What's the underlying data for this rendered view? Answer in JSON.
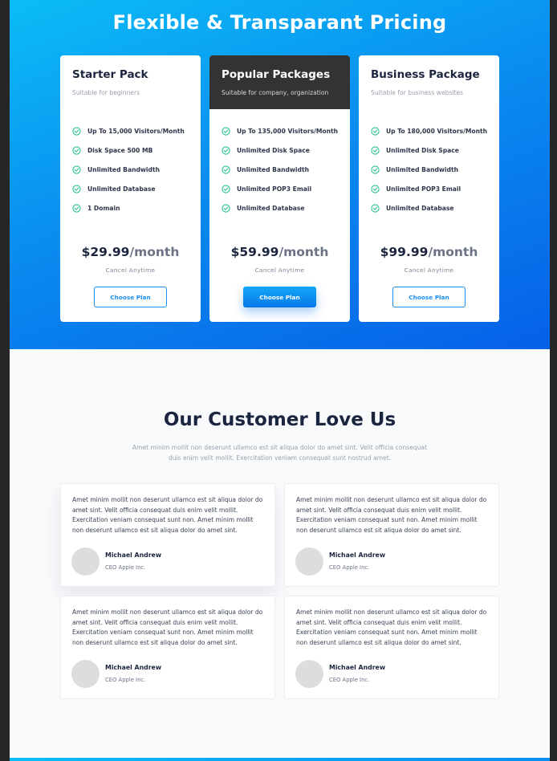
{
  "pricing": {
    "title": "Flexible & Transparant Pricing",
    "plans": [
      {
        "name": "Starter Pack",
        "description": "Suitable for beginners",
        "features": [
          "Up To 15,000 Visitors/Month",
          "Disk Space 500 MB",
          "Unlimited Bandwidth",
          "Unlimited Database",
          "1 Domain"
        ],
        "price": "$29.99",
        "period": "/month",
        "note": "Cancel Anytime",
        "button": "Choose Plan",
        "featured": false
      },
      {
        "name": "Popular Packages",
        "description": "Suitable for company, organization",
        "features": [
          "Up To 135,000 Visitors/Month",
          "Unlimited Disk Space",
          "Unlimited Bandwidth",
          "Unlimited POP3 Email",
          "Unlimited Database"
        ],
        "price": "$59.99",
        "period": "/month",
        "note": "Cancel Anytime",
        "button": "Choose Plan",
        "featured": true
      },
      {
        "name": "Business Package",
        "description": "Suitable for business websites",
        "features": [
          "Up To 180,000 Visitors/Month",
          "Unlimited Disk Space",
          "Unlimited Bandwidth",
          "Unlimited POP3 Email",
          "Unlimited Database"
        ],
        "price": "$99.99",
        "period": "/month",
        "note": "Cancel Anytime",
        "button": "Choose Plan",
        "featured": false
      }
    ],
    "check_icon": "check-circle-icon"
  },
  "testimonials": {
    "title": "Our Customer Love Us",
    "subtitle": "Amet minim mollit non deserunt ullamco est sit aliqua dolor do amet sint. Velit officia consequat duis enim velit mollit. Exercitation veniam consequat sunt nostrud amet.",
    "items": [
      {
        "quote": "Amet minim mollit non deserunt ullamco est sit aliqua dolor do amet sint. Velit officia consequat duis enim velit mollit. Exercitation veniam consequat sunt non. Amet minim mollit non deserunt ullamco est sit aliqua dolor do amet sint.",
        "name": "Michael Andrew",
        "role": "CEO Apple Inc."
      },
      {
        "quote": "Amet minim mollit non deserunt ullamco est sit aliqua dolor do amet sint. Velit officia consequat duis enim velit mollit. Exercitation veniam consequat sunt non. Amet minim mollit non deserunt ullamco est sit aliqua dolor do amet sint.",
        "name": "Michael Andrew",
        "role": "CEO Apple Inc."
      },
      {
        "quote": "Amet minim mollit non deserunt ullamco est sit aliqua dolor do amet sint. Velit officia consequat duis enim velit mollit. Exercitation veniam consequat sunt non. Amet minim mollit non deserunt ullamco est sit aliqua dolor do amet sint.",
        "name": "Michael Andrew",
        "role": "CEO Apple Inc."
      },
      {
        "quote": "Amet minim mollit non deserunt ullamco est sit aliqua dolor do amet sint. Velit officia consequat duis enim velit mollit. Exercitation veniam consequat sunt non. Amet minim mollit non deserunt ullamco est sit aliqua dolor do amet sint.",
        "name": "Michael Andrew",
        "role": "CEO Apple Inc."
      }
    ]
  },
  "colors": {
    "accent": "#1a8ff0",
    "gradient_start": "#0bbcf6",
    "gradient_end": "#0660e8",
    "featured_header": "#333333",
    "check": "#2bc48a",
    "heading": "#1c2540"
  }
}
